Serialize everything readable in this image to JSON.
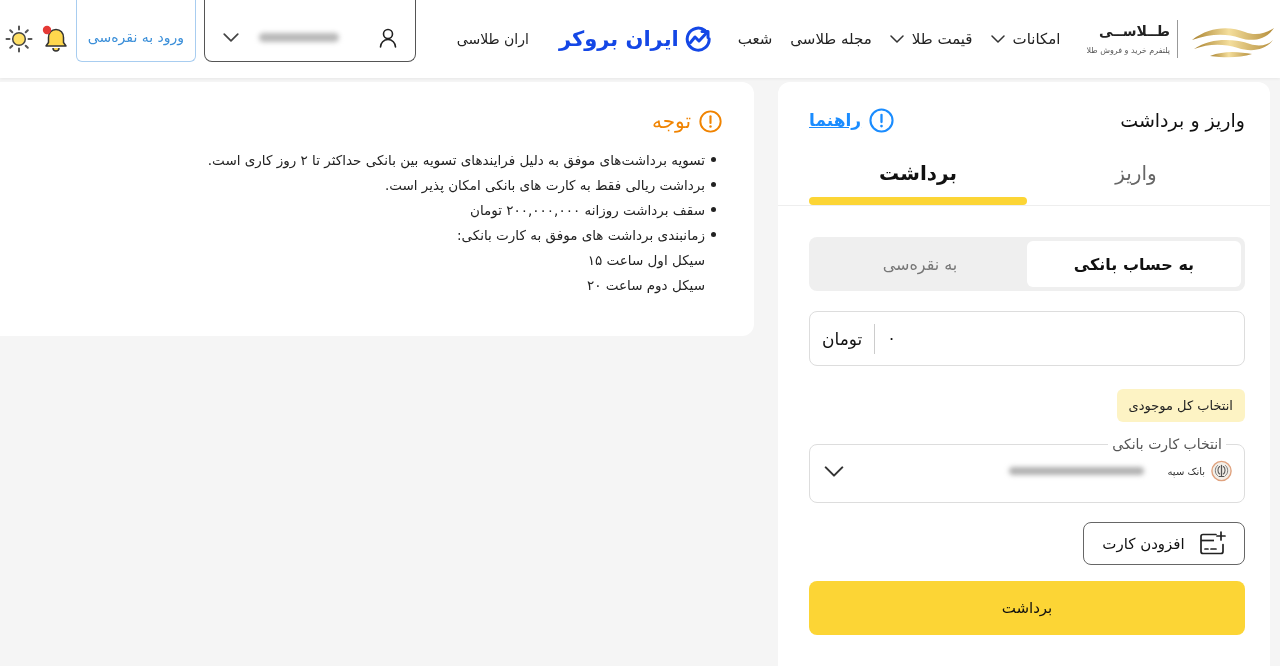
{
  "header": {
    "brand": {
      "name": "طــلاســی",
      "tagline": "پلتفرم خرید و فروش طلا"
    },
    "nav": [
      {
        "label": "امکانات",
        "dropdown": true
      },
      {
        "label": "قیمت طلا",
        "dropdown": true
      },
      {
        "label": "مجله طلاسی",
        "dropdown": false
      },
      {
        "label": "شعب",
        "dropdown": false
      }
    ],
    "partner_logo": "ایران بروکر",
    "partner_text": "اران طلاسی",
    "login_button": "ورود به نقره‌سی",
    "notifications": {
      "unread": true
    }
  },
  "notice": {
    "title": "توجه",
    "items": [
      {
        "kind": "bullet",
        "text": "تسویه برداشت‌های موفق به دلیل فرایندهای تسویه بین بانکی حداکثر تا ۲ روز کاری است."
      },
      {
        "kind": "bullet",
        "text": "برداشت ریالی فقط به کارت های بانکی امکان پذیر است."
      },
      {
        "kind": "bullet",
        "text": "سقف برداشت روزانه ۲۰۰,۰۰۰,۰۰۰ تومان"
      },
      {
        "kind": "bullet",
        "text": "زمانبندی برداشت های موفق به کارت بانکی:"
      },
      {
        "kind": "plain",
        "text": "سیکل اول ساعت ۱۵"
      },
      {
        "kind": "plain",
        "text": "سیکل دوم ساعت ۲۰"
      }
    ]
  },
  "transfer": {
    "title": "واریز و برداشت",
    "help_link": "راهنما",
    "tabs": [
      {
        "label": "واریز",
        "selected": false
      },
      {
        "label": "برداشت",
        "selected": true
      }
    ],
    "destinations": [
      {
        "label": "به حساب بانکی",
        "selected": true
      },
      {
        "label": "به نقره‌سی",
        "selected": false
      }
    ],
    "amount": {
      "value": "۰",
      "unit": "تومان"
    },
    "select_all": "انتخاب کل موجودی",
    "card_select": {
      "legend": "انتخاب کارت بانکی",
      "bank": "بانک سپه"
    },
    "add_card": "افزودن کارت",
    "submit": "برداشت"
  }
}
